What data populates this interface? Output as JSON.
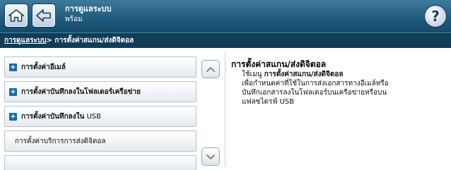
{
  "header": {
    "title": "การดูแลระบบ",
    "subtitle": "พร้อม",
    "home_icon": "home-icon",
    "back_icon": "back-arrow-icon",
    "help_icon": "help-icon",
    "help_glyph": "?"
  },
  "breadcrumb": {
    "root": "การดูแลระบบ",
    "separator": "> ",
    "current": "การตั้งค่าสแกน/ส่งดิจิตอล"
  },
  "menu": {
    "items": [
      {
        "label": "การตั้งค่าอีเมล์",
        "icon": "plus-icon"
      },
      {
        "label": "การตั้งค่าบันทึกลงในโฟลเดอร์เครือข่าย",
        "icon": "plus-icon"
      },
      {
        "label_bold": "การตั้งค่าบันทึกลงใน",
        "label_plain": " USB",
        "icon": "plus-icon"
      },
      {
        "label": "การตั้งค่าบริการการส่งดิจิตอล"
      },
      {
        "label": ""
      }
    ],
    "scroll_up_icon": "chevron-up-icon",
    "scroll_down_icon": "chevron-down-icon"
  },
  "info": {
    "title": "การตั้งค่าสแกน/ส่งดิจิตอล",
    "body_prefix": "ใช้เมนู ",
    "body_bold": "การตั้งค่าสแกน/ส่งดิจิตอล",
    "body_line2": "เพื่อกำหนดค่าที่ใช้ในการส่งเอกสารทางอีเมล์หรือ",
    "body_line3": "บันทึกเอกสารลงในโฟลเดอร์บนเครือข่ายหรือบน",
    "body_line4": "แฟลชไดรฟ์ USB"
  },
  "colors": {
    "header_bg": "#1f5a7c",
    "breadcrumb_bg": "#0f3c57",
    "plus_icon": "#1a6a9a"
  }
}
